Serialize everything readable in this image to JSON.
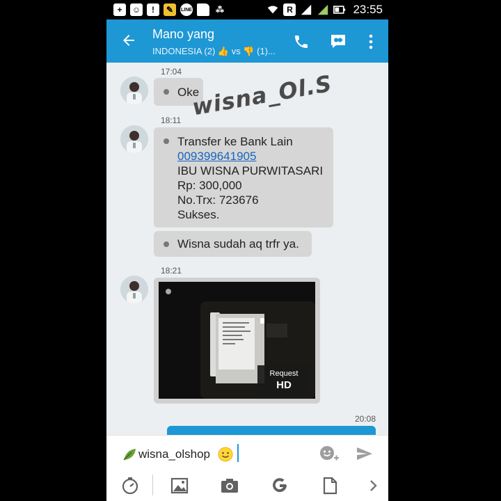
{
  "status_bar": {
    "time": "23:55",
    "icons": [
      "plus-icon",
      "bbm-icon",
      "alert-icon",
      "broom-icon",
      "line-icon",
      "sd-card-icon",
      "blackberry-icon",
      "wifi-icon",
      "roaming-icon",
      "signal-icon",
      "battery-icon"
    ],
    "line_label": "LINE",
    "roaming_label": "R"
  },
  "header": {
    "title": "Mano yang",
    "subtitle": "INDONESIA (2) 👍 vs 👎 (1)..."
  },
  "chat": {
    "messages": [
      {
        "time": "17:04",
        "lines": [
          "Oke"
        ]
      },
      {
        "time": "18:11",
        "line1": "Transfer ke Bank Lain",
        "link": "009399641905",
        "line3": "IBU WISNA  PURWITASARI",
        "line4": "Rp: 300,000",
        "line5": "No.Trx: 723676",
        "line6": "Sukses."
      },
      {
        "text": "Wisna sudah aq trfr ya."
      },
      {
        "time": "18:21",
        "request_line1": "Request",
        "request_line2": "HD"
      },
      {
        "time": "20:08"
      }
    ],
    "watermark": "wisna_Ol.S"
  },
  "composer": {
    "value": "wisna_olshop"
  },
  "colors": {
    "accent": "#1e97d5",
    "bubble": "#d6d6d6",
    "background": "#eceff1"
  },
  "toolbar": {
    "icons": [
      "timer-icon",
      "gallery-icon",
      "camera-icon",
      "google-icon",
      "document-icon",
      "chevron-right-icon"
    ]
  }
}
